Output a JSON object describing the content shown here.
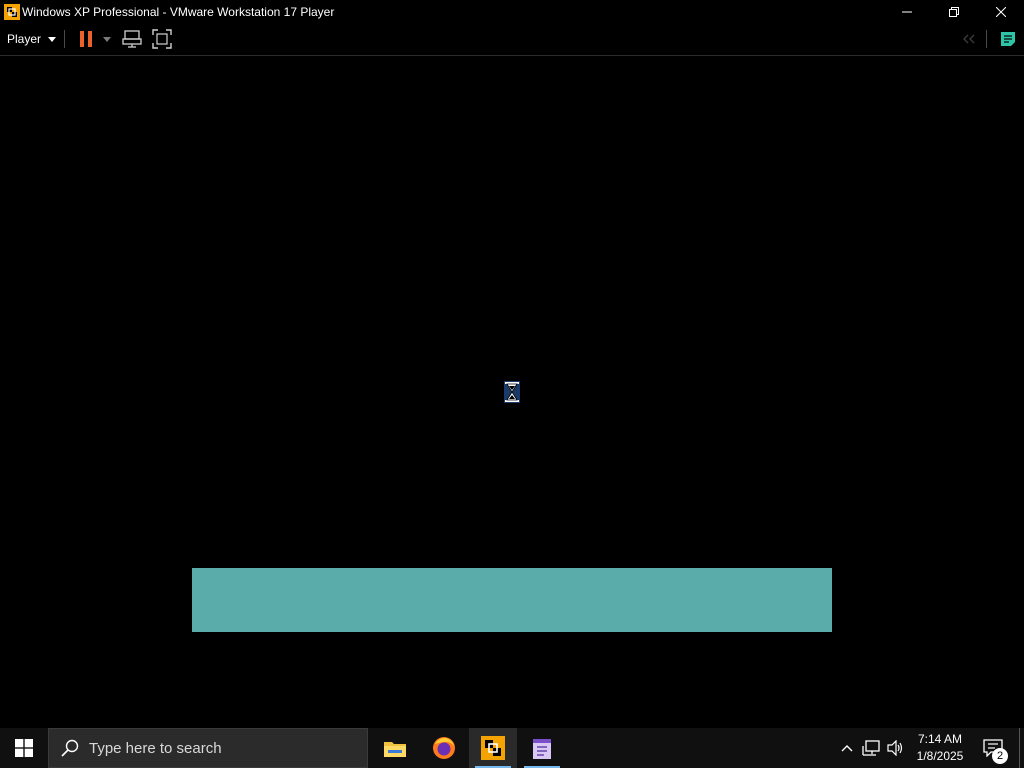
{
  "window": {
    "title": "Windows XP Professional - VMware Workstation 17 Player",
    "app_icon": "vmware-player-icon",
    "controls": [
      "minimize-icon",
      "restore-icon",
      "close-icon"
    ]
  },
  "toolbar": {
    "player_label": "Player",
    "buttons": [
      "pause-icon",
      "send-ctrl-alt-del-icon",
      "full-screen-icon",
      "back-arrows-icon",
      "notes-icon"
    ],
    "pause_color": "#e8632b"
  },
  "guest": {
    "state": "booting",
    "cursor": "hourglass-icon",
    "boot_bar_color": "#5aacab"
  },
  "taskbar": {
    "search_placeholder": "Type here to search",
    "apps": [
      "file-explorer-icon",
      "firefox-icon",
      "vmware-player-icon",
      "notepad-icon"
    ],
    "active_app": "vmware-player-icon",
    "tray_icons": [
      "chevron-up-icon",
      "network-icon",
      "volume-icon"
    ],
    "clock": {
      "time": "7:14 AM",
      "date": "1/8/2025"
    },
    "notification_count": "2"
  }
}
